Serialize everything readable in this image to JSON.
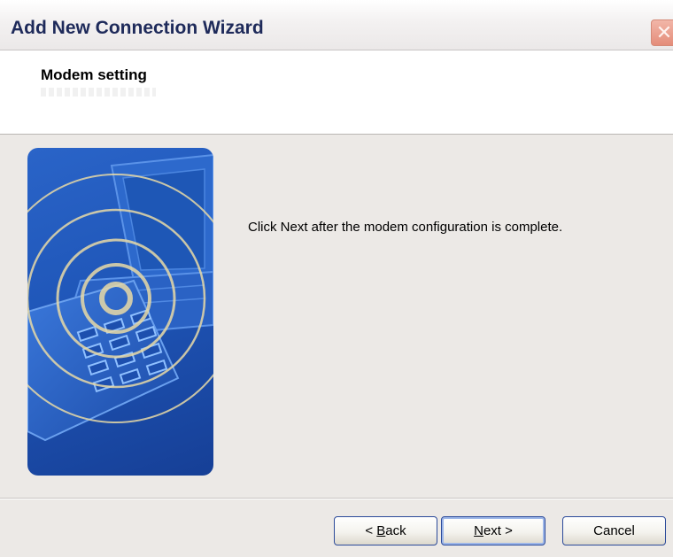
{
  "window": {
    "title": "Add New Connection Wizard",
    "close_glyph": "✕"
  },
  "header": {
    "title": "Modem setting"
  },
  "main": {
    "message": "Click Next after the modem configuration is complete.",
    "illustration": "phone-and-laptop-illustration"
  },
  "buttons": {
    "back": {
      "prefix": "< ",
      "mnemonic": "B",
      "rest": "ack"
    },
    "next": {
      "mnemonic": "N",
      "rest": "ext",
      "suffix": " >"
    },
    "cancel": "Cancel"
  },
  "colors": {
    "title_text": "#1e2a5a",
    "illustration_blue": "#1f56b8",
    "dialog_bg": "#ece9e6"
  }
}
